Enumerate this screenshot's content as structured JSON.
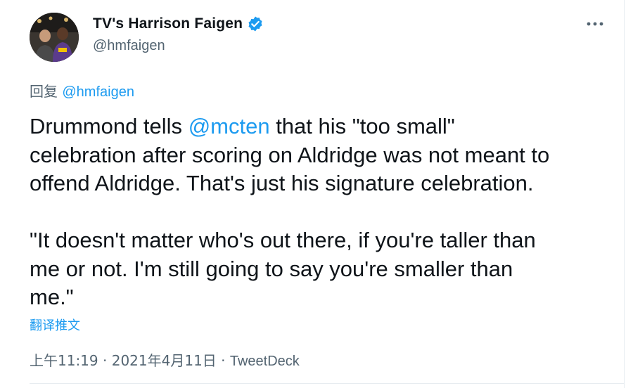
{
  "author": {
    "display_name": "TV's Harrison Faigen",
    "handle": "@hmfaigen",
    "verified": true
  },
  "more_icon": "more-horizontal-icon",
  "reply": {
    "prefix": "回复 ",
    "to_handle": "@hmfaigen"
  },
  "tweet": {
    "line1_a": "Drummond tells ",
    "mention": "@mcten",
    "line1_b": " that his \"too small\"\ncelebration after scoring on Aldridge was not meant to\noffend Aldridge. That's just his signature celebration.\n\n\"It doesn't matter who's out there, if you're taller than\nme or not. I'm still going to say you're smaller than\nme.\""
  },
  "translate_label": "翻译推文",
  "meta": {
    "time": "上午11:19",
    "separator1": " · ",
    "date": "2021年4月11日",
    "separator2": " · ",
    "source": "TweetDeck"
  },
  "colors": {
    "link": "#1d9bf0",
    "secondary_text": "#536471",
    "primary_text": "#0f1419",
    "verified": "#1d9bf0"
  }
}
